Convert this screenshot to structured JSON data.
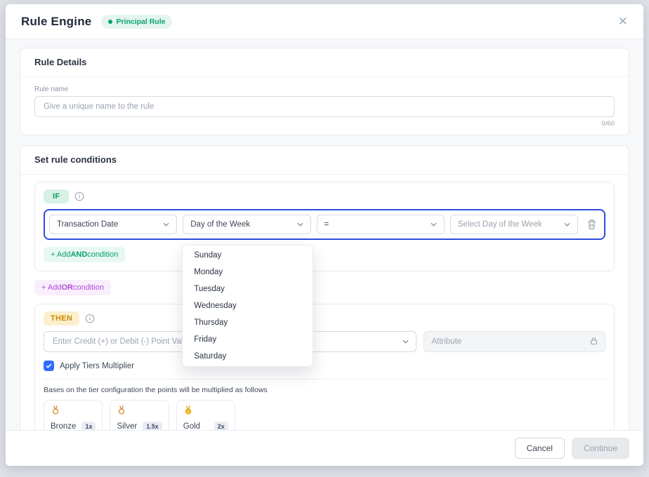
{
  "header": {
    "title": "Rule Engine",
    "badge": "Principal Rule"
  },
  "rule_details": {
    "title": "Rule Details",
    "name_label": "Rule name",
    "name_placeholder": "Give a unique name to the rule",
    "char_counter": "0/60"
  },
  "conditions": {
    "title": "Set rule conditions",
    "if_label": "IF",
    "field_select": "Transaction Date",
    "subfield_select": "Day of the Week",
    "operator_select": "=",
    "value_placeholder": "Select Day of the Week",
    "add_and": {
      "prefix": "+ Add ",
      "bold": "AND",
      "suffix": " condition"
    },
    "add_or": {
      "prefix": "+ Add ",
      "bold": "OR",
      "suffix": " condition"
    }
  },
  "day_dropdown": {
    "options": [
      "Sunday",
      "Monday",
      "Tuesday",
      "Wednesday",
      "Thursday",
      "Friday",
      "Saturday"
    ]
  },
  "then_section": {
    "label": "THEN",
    "points_placeholder": "Enter Credit (+) or Debit (-) Point Value",
    "attribute_label": "Attribute",
    "apply_tiers_label": "Apply Tiers Multiplier",
    "tiers_note": "Bases on the tier configuration the points will be multiplied as follows",
    "tiers": [
      {
        "name": "Bronze",
        "multiplier": "1x"
      },
      {
        "name": "Silver",
        "multiplier": "1.5x"
      },
      {
        "name": "Gold",
        "multiplier": "2x"
      }
    ]
  },
  "footer": {
    "cancel_label": "Cancel",
    "continue_label": "Continue"
  },
  "colors": {
    "accent_green": "#0aa06e",
    "accent_purple": "#b24bd8",
    "accent_amber": "#cf8a00",
    "highlight_blue": "#2c4ddd",
    "checkbox_blue": "#2f6bff"
  }
}
